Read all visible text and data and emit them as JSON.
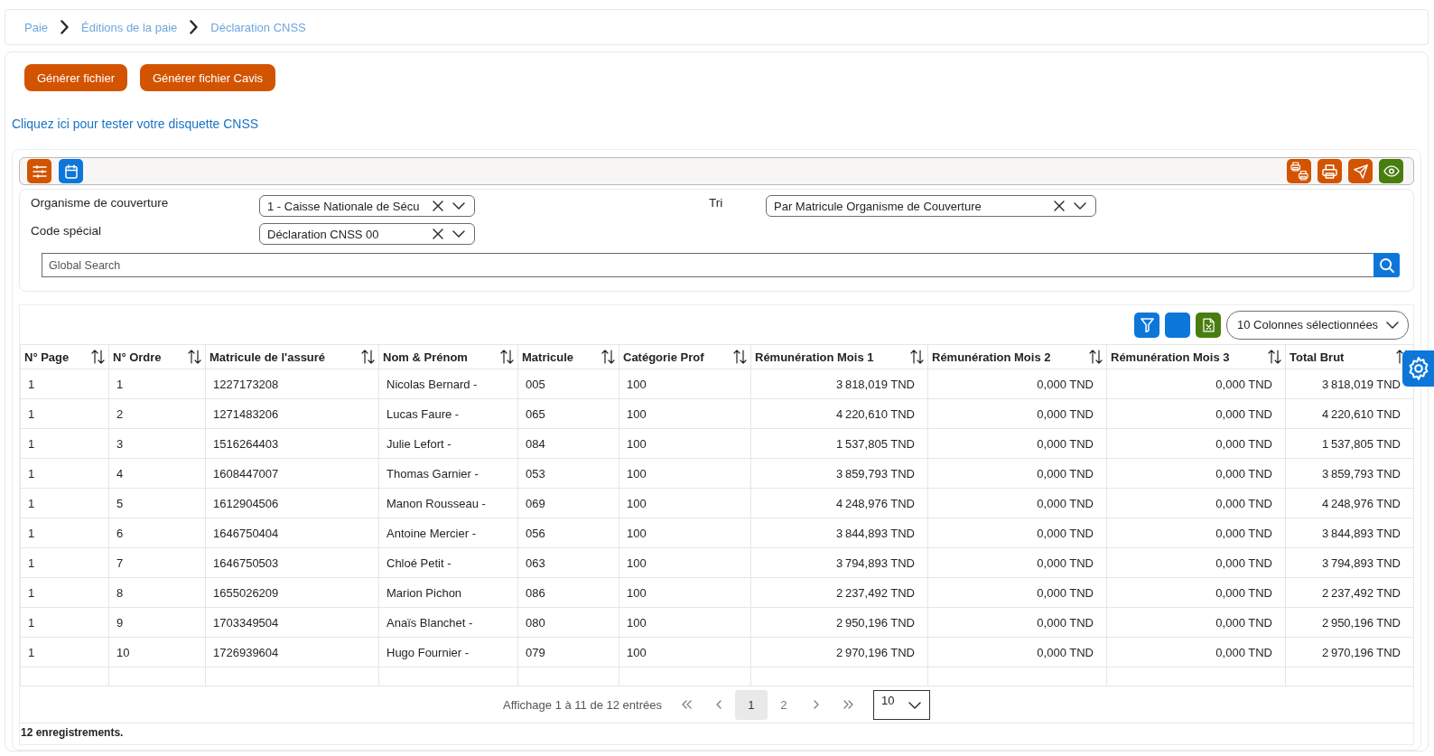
{
  "breadcrumb": [
    {
      "label": "Paie"
    },
    {
      "label": "Éditions de la paie"
    },
    {
      "label": "Déclaration CNSS"
    }
  ],
  "actions": [
    {
      "label": "Générer fichier"
    },
    {
      "label": "Générer fichier Cavis"
    }
  ],
  "test_link": {
    "label": "Cliquez ici pour tester votre disquette CNSS"
  },
  "filters": [
    {
      "label": "Organisme de couverture",
      "value": "1 - Caisse Nationale de Sécu"
    },
    {
      "label": "Tri",
      "value": "Par Matricule Organisme de Couverture"
    },
    {
      "label": "Code spécial",
      "value": "Déclaration CNSS 00"
    }
  ],
  "search": {
    "placeholder": "Global Search"
  },
  "table": {
    "column_picker": "10 Colonnes sélectionnées",
    "columns": [
      {
        "label": "N° Page",
        "kind": "text"
      },
      {
        "label": "N° Ordre",
        "kind": "text"
      },
      {
        "label": "Matricule de l'assuré",
        "kind": "text"
      },
      {
        "label": "Nom & Prénom",
        "kind": "text"
      },
      {
        "label": "Matricule",
        "kind": "text"
      },
      {
        "label": "Catégorie Prof",
        "kind": "text"
      },
      {
        "label": "Rémunération Mois 1",
        "kind": "amount"
      },
      {
        "label": "Rémunération Mois 2",
        "kind": "amount"
      },
      {
        "label": "Rémunération Mois 3",
        "kind": "amount"
      },
      {
        "label": "Total Brut",
        "kind": "amount"
      }
    ],
    "rows": [
      [
        "1",
        "1",
        "1227173208",
        "Nicolas Bernard -",
        "005",
        "100",
        "3 818,019 TND",
        "0,000 TND",
        "0,000 TND",
        "3 818,019 TND"
      ],
      [
        "1",
        "2",
        "1271483206",
        "Lucas Faure -",
        "065",
        "100",
        "4 220,610 TND",
        "0,000 TND",
        "0,000 TND",
        "4 220,610 TND"
      ],
      [
        "1",
        "3",
        "1516264403",
        "Julie Lefort -",
        "084",
        "100",
        "1 537,805 TND",
        "0,000 TND",
        "0,000 TND",
        "1 537,805 TND"
      ],
      [
        "1",
        "4",
        "1608447007",
        "Thomas Garnier -",
        "053",
        "100",
        "3 859,793 TND",
        "0,000 TND",
        "0,000 TND",
        "3 859,793 TND"
      ],
      [
        "1",
        "5",
        "1612904506",
        "Manon Rousseau -",
        "069",
        "100",
        "4 248,976 TND",
        "0,000 TND",
        "0,000 TND",
        "4 248,976 TND"
      ],
      [
        "1",
        "6",
        "1646750404",
        "Antoine Mercier -",
        "056",
        "100",
        "3 844,893 TND",
        "0,000 TND",
        "0,000 TND",
        "3 844,893 TND"
      ],
      [
        "1",
        "7",
        "1646750503",
        "Chloé Petit -",
        "063",
        "100",
        "3 794,893 TND",
        "0,000 TND",
        "0,000 TND",
        "3 794,893 TND"
      ],
      [
        "1",
        "8",
        "1655026209",
        "Marion Pichon",
        "086",
        "100",
        "2 237,492 TND",
        "0,000 TND",
        "0,000 TND",
        "2 237,492 TND"
      ],
      [
        "1",
        "9",
        "1703349504",
        "Anaïs Blanchet -",
        "080",
        "100",
        "2 950,196 TND",
        "0,000 TND",
        "0,000 TND",
        "2 950,196 TND"
      ],
      [
        "1",
        "10",
        "1726939604",
        "Hugo Fournier -",
        "079",
        "100",
        "2 970,196 TND",
        "0,000 TND",
        "0,000 TND",
        "2 970,196 TND"
      ]
    ]
  },
  "pagination": {
    "summary": "Affichage 1 à 11 de 12 entrées",
    "pages": [
      {
        "label": "1",
        "selected": true
      },
      {
        "label": "2",
        "selected": false
      }
    ],
    "page_size": "10"
  },
  "record_count": "12 enregistrements."
}
